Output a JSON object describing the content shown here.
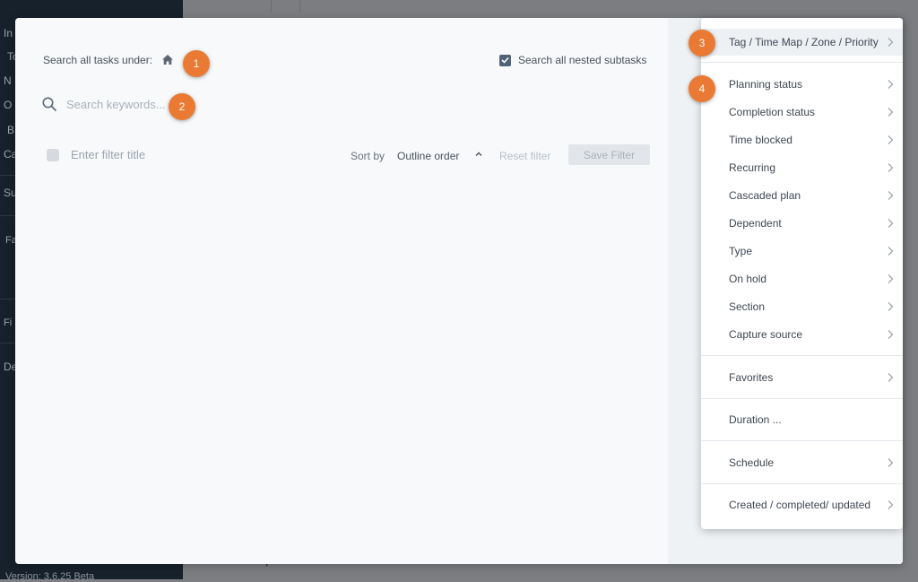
{
  "background": {
    "sidebar_letters": [
      "In",
      "To",
      "N",
      "O",
      "B",
      "Ca",
      "Su",
      "Fa",
      "Fi",
      "De"
    ],
    "version": "Version: 3.6.25 Beta",
    "plus": "+"
  },
  "modal": {
    "search_under_label": "Search all tasks under:",
    "nested_label": "Search all nested subtasks",
    "search_placeholder": "Search keywords...",
    "filter_title_placeholder": "Enter filter title",
    "sort_by_label": "Sort by",
    "sort_value": "Outline order",
    "reset_label": "Reset filter",
    "save_label": "Save Filter"
  },
  "menu": {
    "items": [
      {
        "label": "Tag / Time Map / Zone / Priority"
      },
      {
        "label": "Planning status"
      },
      {
        "label": "Completion status"
      },
      {
        "label": "Time blocked"
      },
      {
        "label": "Recurring"
      },
      {
        "label": "Cascaded plan"
      },
      {
        "label": "Dependent"
      },
      {
        "label": "Type"
      },
      {
        "label": "On hold"
      },
      {
        "label": "Section"
      },
      {
        "label": "Capture source"
      },
      {
        "label": "Favorites"
      },
      {
        "label": "Duration ..."
      },
      {
        "label": "Schedule"
      },
      {
        "label": "Created / completed/ updated"
      }
    ]
  },
  "annotations": [
    "1",
    "2",
    "3",
    "4"
  ],
  "colors": {
    "accent": "#ea7a33",
    "sidebar_bg": "#17212b",
    "checkbox_checked": "#4f6277"
  }
}
